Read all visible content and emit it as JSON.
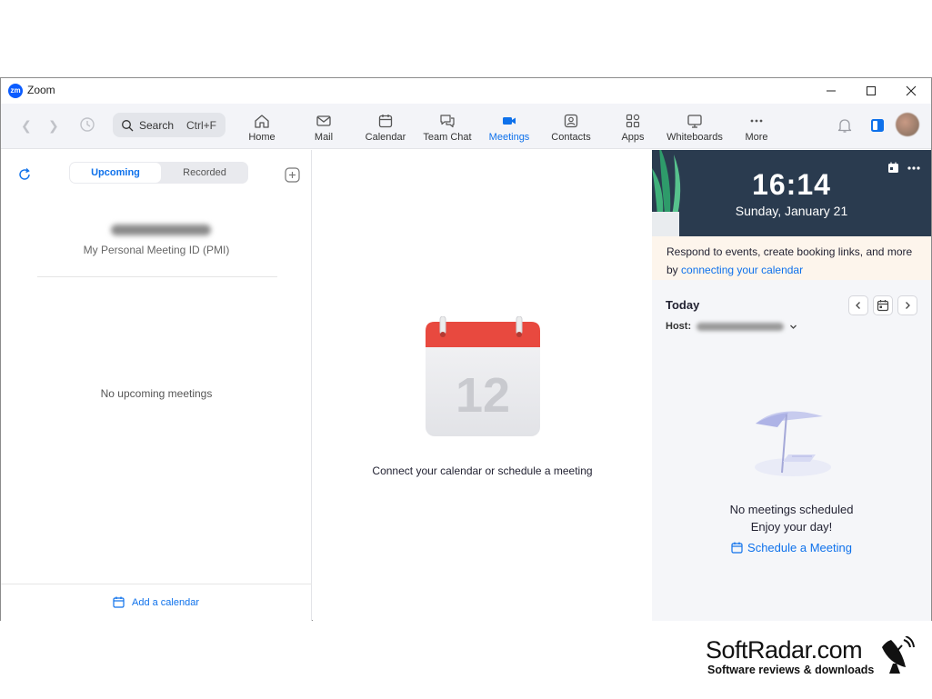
{
  "window": {
    "logo_text": "zm",
    "title": "Zoom"
  },
  "toolbar": {
    "search_placeholder": "Search",
    "search_shortcut": "Ctrl+F",
    "tabs": [
      {
        "label": "Home",
        "icon": "home-icon"
      },
      {
        "label": "Mail",
        "icon": "mail-icon"
      },
      {
        "label": "Calendar",
        "icon": "calendar-icon"
      },
      {
        "label": "Team Chat",
        "icon": "chat-icon"
      },
      {
        "label": "Meetings",
        "icon": "video-icon",
        "active": true
      },
      {
        "label": "Contacts",
        "icon": "contacts-icon"
      },
      {
        "label": "Apps",
        "icon": "apps-icon"
      },
      {
        "label": "Whiteboards",
        "icon": "whiteboard-icon"
      },
      {
        "label": "More",
        "icon": "more-icon"
      }
    ]
  },
  "left_pane": {
    "segments": [
      "Upcoming",
      "Recorded"
    ],
    "active_segment": "Upcoming",
    "pmi_label": "My Personal Meeting ID (PMI)",
    "empty_text": "No upcoming meetings",
    "add_calendar": "Add a calendar"
  },
  "middle_pane": {
    "calendar_day": "12",
    "message": "Connect your calendar or schedule a meeting"
  },
  "right_pane": {
    "time": "16:14",
    "date": "Sunday, January 21",
    "banner_text": "Respond to events, create booking links, and more by ",
    "banner_link": "connecting your calendar",
    "today_label": "Today",
    "host_label": "Host:",
    "empty_line1": "No meetings scheduled",
    "empty_line2": "Enjoy your day!",
    "schedule_link": "Schedule a Meeting"
  },
  "watermark": {
    "brand": "SoftRadar.com",
    "tagline": "Software reviews & downloads"
  },
  "colors": {
    "accent": "#0e71eb",
    "hero_bg": "#2a3b4f",
    "banner_bg": "#fdf5ec",
    "calendar_red": "#e8493f"
  }
}
